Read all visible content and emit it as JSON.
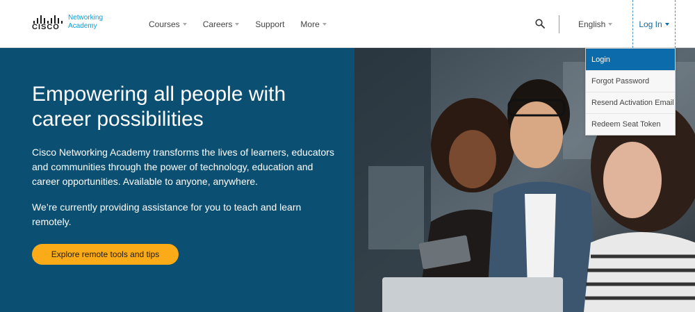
{
  "brand": {
    "wordmark": "CISCO",
    "product_line1": "Networking",
    "product_line2": "Academy",
    "accent_color": "#049fd9"
  },
  "nav": {
    "items": [
      {
        "label": "Courses",
        "has_dropdown": true
      },
      {
        "label": "Careers",
        "has_dropdown": true
      },
      {
        "label": "Support",
        "has_dropdown": false
      },
      {
        "label": "More",
        "has_dropdown": true
      }
    ],
    "search_icon": "search-icon",
    "language": "English",
    "login": "Log In"
  },
  "login_menu": {
    "items": [
      "Login",
      "Forgot Password",
      "Resend Activation Email",
      "Redeem Seat Token"
    ],
    "active_index": 0,
    "active_color": "#0b6bab"
  },
  "hero": {
    "title": "Empowering all people with career possibilities",
    "paragraph1": "Cisco Networking Academy transforms the lives of learners, educators and communities through the power of technology, education and career opportunities. Available to anyone, anywhere.",
    "paragraph2": "We’re currently providing assistance for you to teach and learn remotely.",
    "cta_label": "Explore remote tools and tips",
    "panel_color": "#0b4f72",
    "cta_color": "#fbab18"
  }
}
